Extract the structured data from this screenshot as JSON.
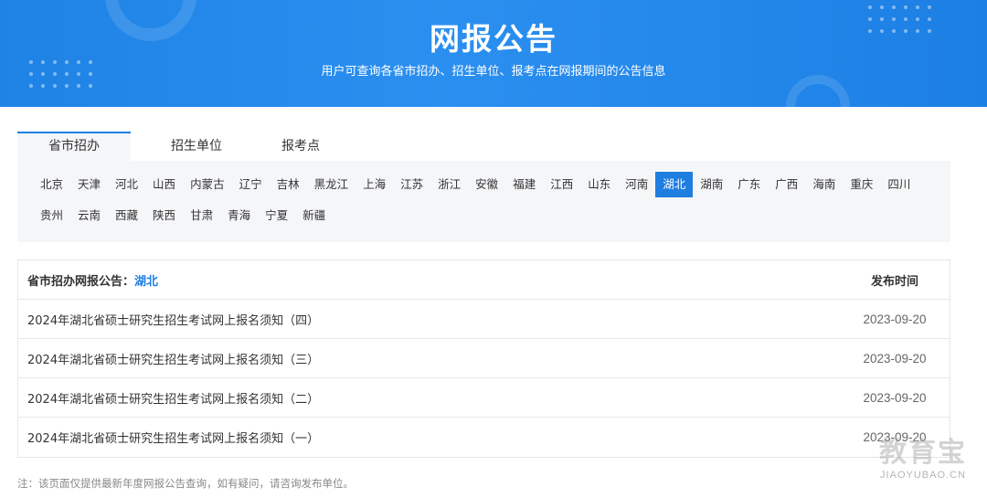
{
  "banner": {
    "title": "网报公告",
    "subtitle": "用户可查询各省市招办、招生单位、报考点在网报期间的公告信息"
  },
  "tabs": [
    {
      "label": "省市招办",
      "active": true
    },
    {
      "label": "招生单位",
      "active": false
    },
    {
      "label": "报考点",
      "active": false
    }
  ],
  "regions_row1": [
    "北京",
    "天津",
    "河北",
    "山西",
    "内蒙古",
    "辽宁",
    "吉林",
    "黑龙江",
    "上海",
    "江苏",
    "浙江",
    "安徽",
    "福建",
    "江西",
    "山东",
    "河南",
    "湖北",
    "湖南",
    "广东",
    "广西",
    "海南",
    "重庆",
    "四川"
  ],
  "regions_row2": [
    "贵州",
    "云南",
    "西藏",
    "陕西",
    "甘肃",
    "青海",
    "宁夏",
    "新疆"
  ],
  "selected_region": "湖北",
  "table": {
    "header_label": "省市招办网报公告：",
    "header_province": "湖北",
    "header_date": "发布时间",
    "rows": [
      {
        "title": "2024年湖北省硕士研究生招生考试网上报名须知（四）",
        "date": "2023-09-20"
      },
      {
        "title": "2024年湖北省硕士研究生招生考试网上报名须知（三）",
        "date": "2023-09-20"
      },
      {
        "title": "2024年湖北省硕士研究生招生考试网上报名须知（二）",
        "date": "2023-09-20"
      },
      {
        "title": "2024年湖北省硕士研究生招生考试网上报名须知（一）",
        "date": "2023-09-20"
      }
    ]
  },
  "note": "注：该页面仅提供最新年度网报公告查询，如有疑问，请咨询发布单位。",
  "watermark": {
    "cn": "教育宝",
    "en": "JIAOYUBAO.CN"
  },
  "colors": {
    "accent": "#1f7ee0",
    "banner": "#2b8ff0",
    "panel": "#f5f6f8"
  }
}
